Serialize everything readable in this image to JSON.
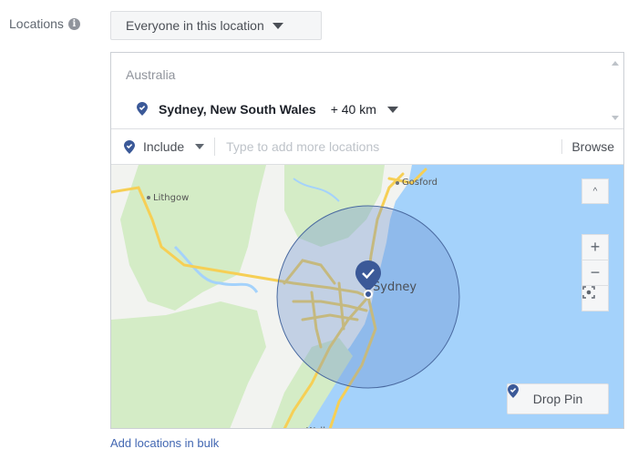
{
  "field_label": "Locations",
  "info_icon": "info-icon",
  "audience_dropdown": {
    "selected": "Everyone in this location"
  },
  "selected_locations": {
    "country": "Australia",
    "items": [
      {
        "name": "Sydney, New South Wales",
        "radius": "+ 40 km",
        "icon": "location-pin-icon"
      }
    ]
  },
  "add_row": {
    "mode": "Include",
    "placeholder": "Type to add more locations",
    "browse_label": "Browse"
  },
  "map": {
    "labels": {
      "lithgow": "Lithgow",
      "gosford": "Gosford",
      "sydney": "Sydney",
      "wollongong": "Wollongong"
    },
    "controls": {
      "collapse": "^",
      "zoom_in": "+",
      "zoom_out": "−"
    },
    "drop_pin_label": "Drop Pin",
    "colors": {
      "water": "#a4d2fb",
      "land": "#f2f3f0",
      "park": "#d4ecc6",
      "road": "#f6cf55",
      "radius_fill": "#6b8fcf",
      "pin": "#3b5998"
    }
  },
  "bulk_link": "Add locations in bulk"
}
